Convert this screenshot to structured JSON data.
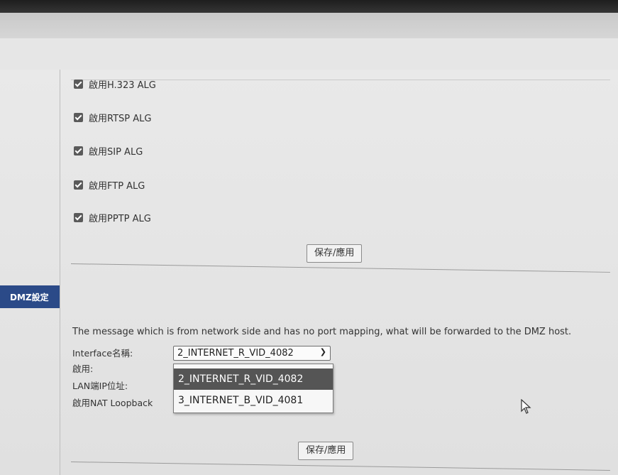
{
  "alg_options": [
    {
      "label": "啟用H.323 ALG",
      "checked": true
    },
    {
      "label": "啟用RTSP ALG",
      "checked": true
    },
    {
      "label": "啟用SIP ALG",
      "checked": true
    },
    {
      "label": "啟用FTP ALG",
      "checked": true
    },
    {
      "label": "啟用PPTP ALG",
      "checked": true
    }
  ],
  "alg_save_button": "保存/應用",
  "dmz": {
    "tab_label": "DMZ設定",
    "message": "The message which is from network side and has no port mapping, what will be forwarded to the DMZ host.",
    "interface_label": "Interface名稱:",
    "enable_label": "啟用:",
    "lan_ip_label": "LAN端IP位址:",
    "nat_loopback_label": "啟用NAT Loopback",
    "interface_selected": "2_INTERNET_R_VID_4082",
    "interface_options": [
      "2_INTERNET_R_VID_4082",
      "3_INTERNET_B_VID_4081"
    ],
    "save_button": "保存/應用"
  },
  "icons": {
    "checkbox": "check-icon",
    "chevron": "chevron-down-icon",
    "cursor": "mouse-pointer-icon"
  }
}
